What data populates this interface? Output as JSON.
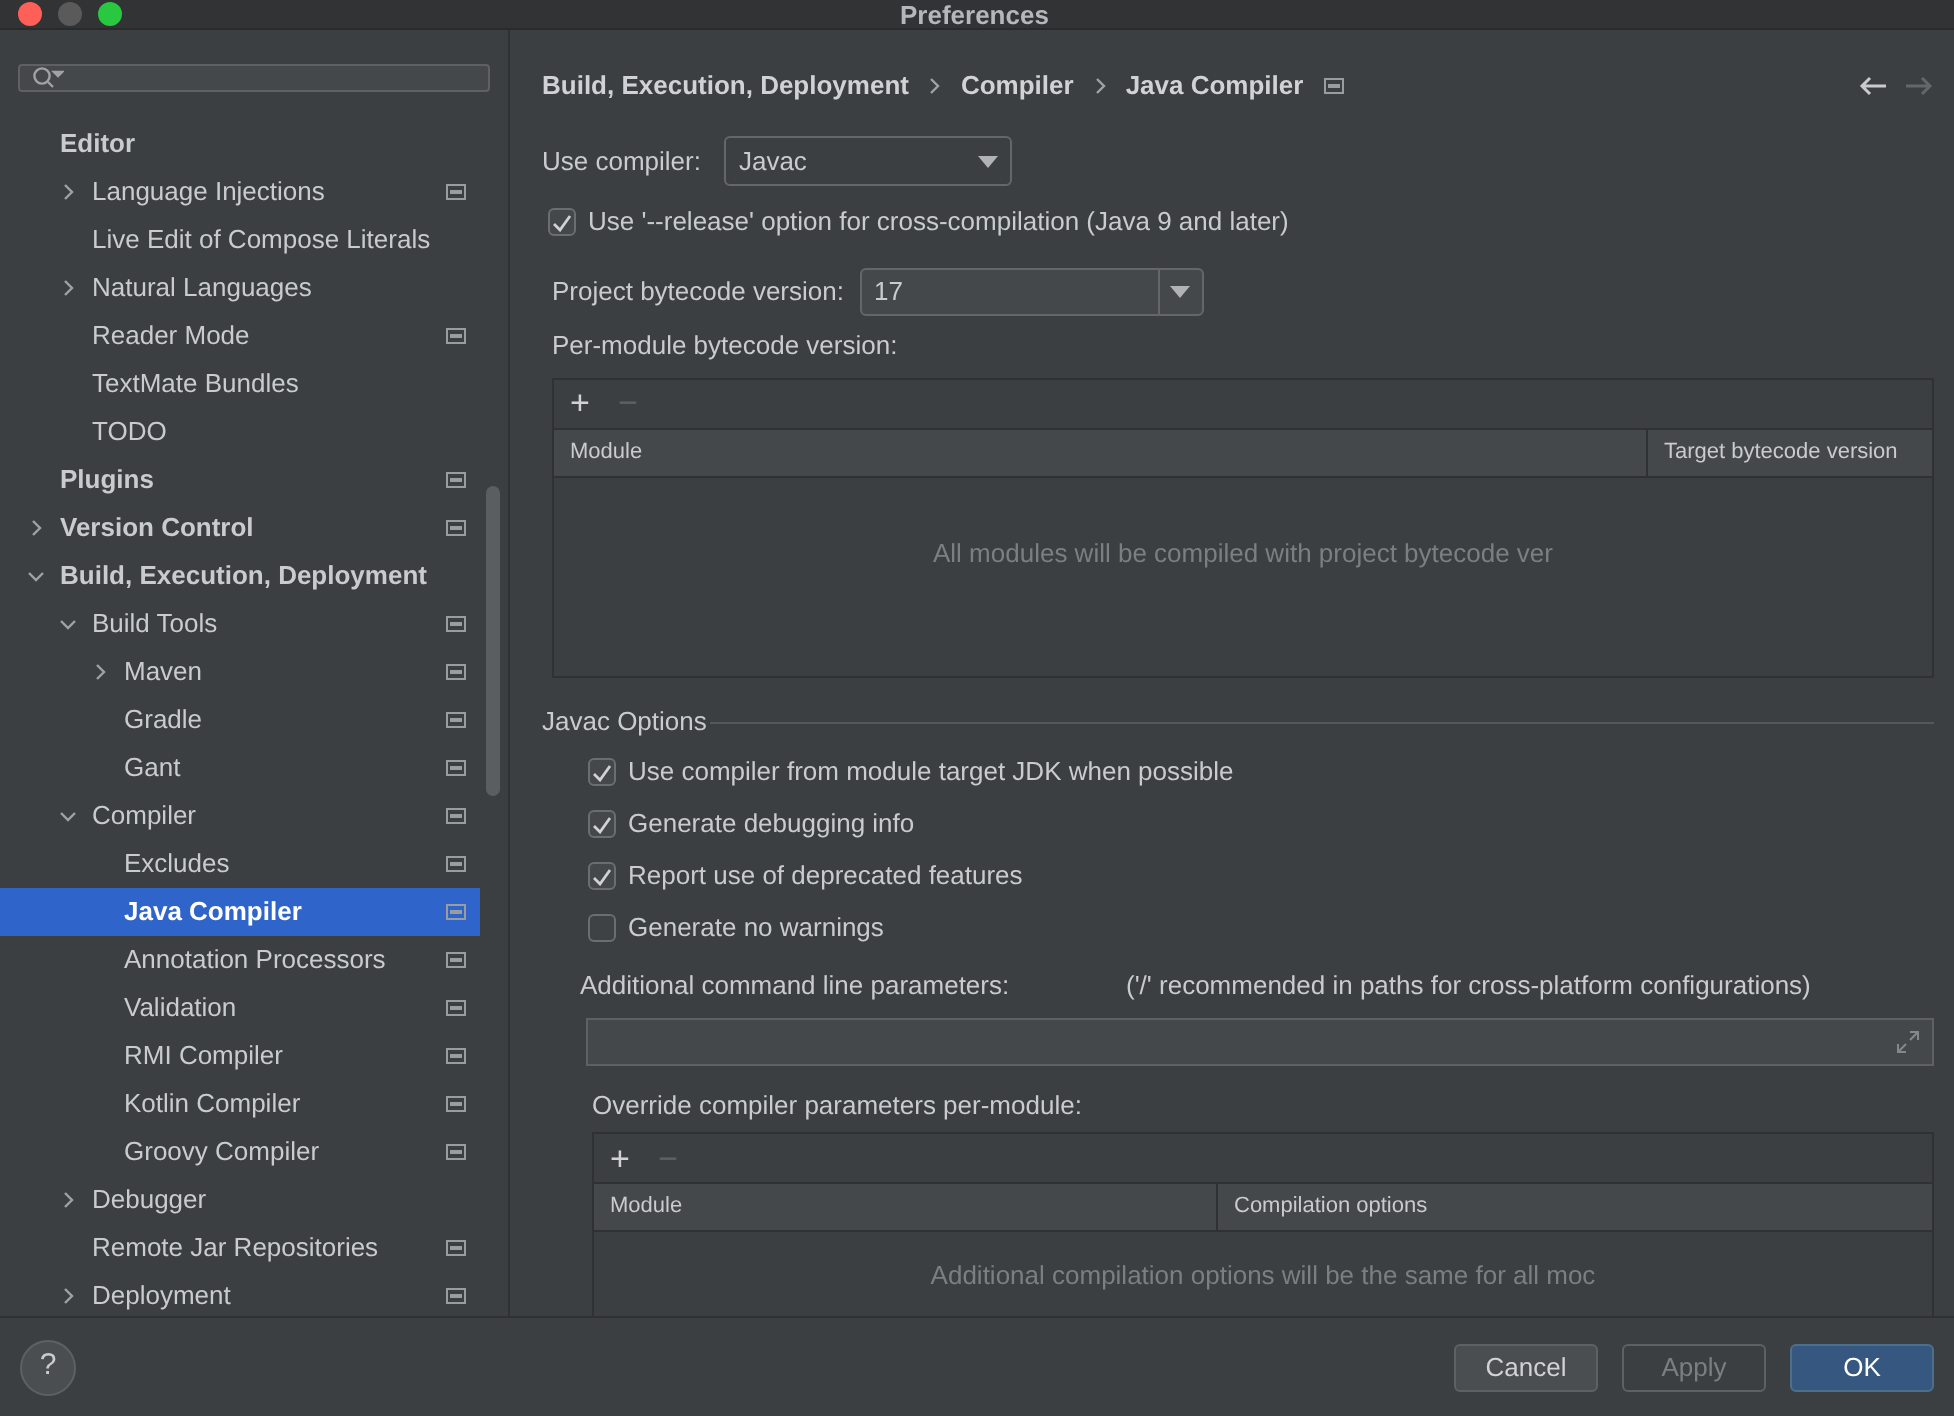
{
  "window": {
    "title": "Preferences"
  },
  "sidebar": {
    "items": [
      {
        "label": "Editor",
        "selected": false,
        "scoped": false,
        "children": [
          {
            "label": "Language Injections",
            "expanded": false,
            "selected": false,
            "scoped": true
          },
          {
            "label": "Live Edit of Compose Literals",
            "selected": false,
            "scoped": false
          },
          {
            "label": "Natural Languages",
            "expanded": false,
            "selected": false,
            "scoped": false
          },
          {
            "label": "Reader Mode",
            "selected": false,
            "scoped": true
          },
          {
            "label": "TextMate Bundles",
            "selected": false,
            "scoped": false
          },
          {
            "label": "TODO",
            "selected": false,
            "scoped": false
          }
        ]
      },
      {
        "label": "Plugins",
        "selected": false,
        "scoped": true
      },
      {
        "label": "Version Control",
        "expanded": false,
        "selected": false,
        "scoped": true
      },
      {
        "label": "Build, Execution, Deployment",
        "expanded": true,
        "selected": false,
        "scoped": false,
        "children": [
          {
            "label": "Build Tools",
            "expanded": true,
            "selected": false,
            "scoped": true,
            "children": [
              {
                "label": "Maven",
                "expanded": false,
                "selected": false,
                "scoped": true
              },
              {
                "label": "Gradle",
                "selected": false,
                "scoped": true
              },
              {
                "label": "Gant",
                "selected": false,
                "scoped": true
              }
            ]
          },
          {
            "label": "Compiler",
            "expanded": true,
            "selected": false,
            "scoped": true,
            "children": [
              {
                "label": "Excludes",
                "selected": false,
                "scoped": true
              },
              {
                "label": "Java Compiler",
                "selected": true,
                "scoped": true
              },
              {
                "label": "Annotation Processors",
                "selected": false,
                "scoped": true
              },
              {
                "label": "Validation",
                "selected": false,
                "scoped": true
              },
              {
                "label": "RMI Compiler",
                "selected": false,
                "scoped": true
              },
              {
                "label": "Kotlin Compiler",
                "selected": false,
                "scoped": true
              },
              {
                "label": "Groovy Compiler",
                "selected": false,
                "scoped": true
              }
            ]
          },
          {
            "label": "Debugger",
            "expanded": false,
            "selected": false,
            "scoped": false
          },
          {
            "label": "Remote Jar Repositories",
            "selected": false,
            "scoped": true
          },
          {
            "label": "Deployment",
            "expanded": false,
            "selected": false,
            "scoped": true
          }
        ]
      }
    ]
  },
  "breadcrumb": {
    "items": [
      "Build, Execution, Deployment",
      "Compiler",
      "Java Compiler"
    ]
  },
  "nav": [
    {
      "kind": "back",
      "disabled": false
    },
    {
      "kind": "forward",
      "disabled": true
    }
  ],
  "use_compiler": {
    "label": "Use compiler:",
    "value": "Javac"
  },
  "release_option": {
    "label": "Use '--release' option for cross-compilation (Java 9 and later)",
    "checked": true
  },
  "bytecode": {
    "label": "Project bytecode version:",
    "value": "17"
  },
  "per_module": {
    "label": "Per-module bytecode version:",
    "toolbar": [
      {
        "symbol": "+",
        "disabled": false
      },
      {
        "symbol": "−",
        "disabled": true
      }
    ],
    "columns": [
      "Module",
      "Target bytecode version"
    ],
    "empty_text": "All modules will be compiled with project bytecode ver"
  },
  "javac_options": {
    "title": "Javac Options",
    "options": [
      {
        "label": "Use compiler from module target JDK when possible",
        "checked": true
      },
      {
        "label": "Generate debugging info",
        "checked": true
      },
      {
        "label": "Report use of deprecated features",
        "checked": true
      },
      {
        "label": "Generate no warnings",
        "checked": false
      }
    ],
    "params_label": "Additional command line parameters:",
    "params_hint": "('/' recommended in paths for cross-platform configurations)",
    "override": {
      "label": "Override compiler parameters per-module:",
      "toolbar": [
        {
          "symbol": "+",
          "disabled": false
        },
        {
          "symbol": "−",
          "disabled": true
        }
      ],
      "columns": [
        "Module",
        "Compilation options"
      ],
      "empty_text": "Additional compilation options will be the same for all moc"
    }
  },
  "help": {
    "symbol": "?"
  },
  "buttons": [
    {
      "label": "Cancel",
      "disabled": false,
      "primary": false
    },
    {
      "label": "Apply",
      "disabled": true,
      "primary": false
    },
    {
      "label": "OK",
      "disabled": false,
      "primary": true
    }
  ]
}
